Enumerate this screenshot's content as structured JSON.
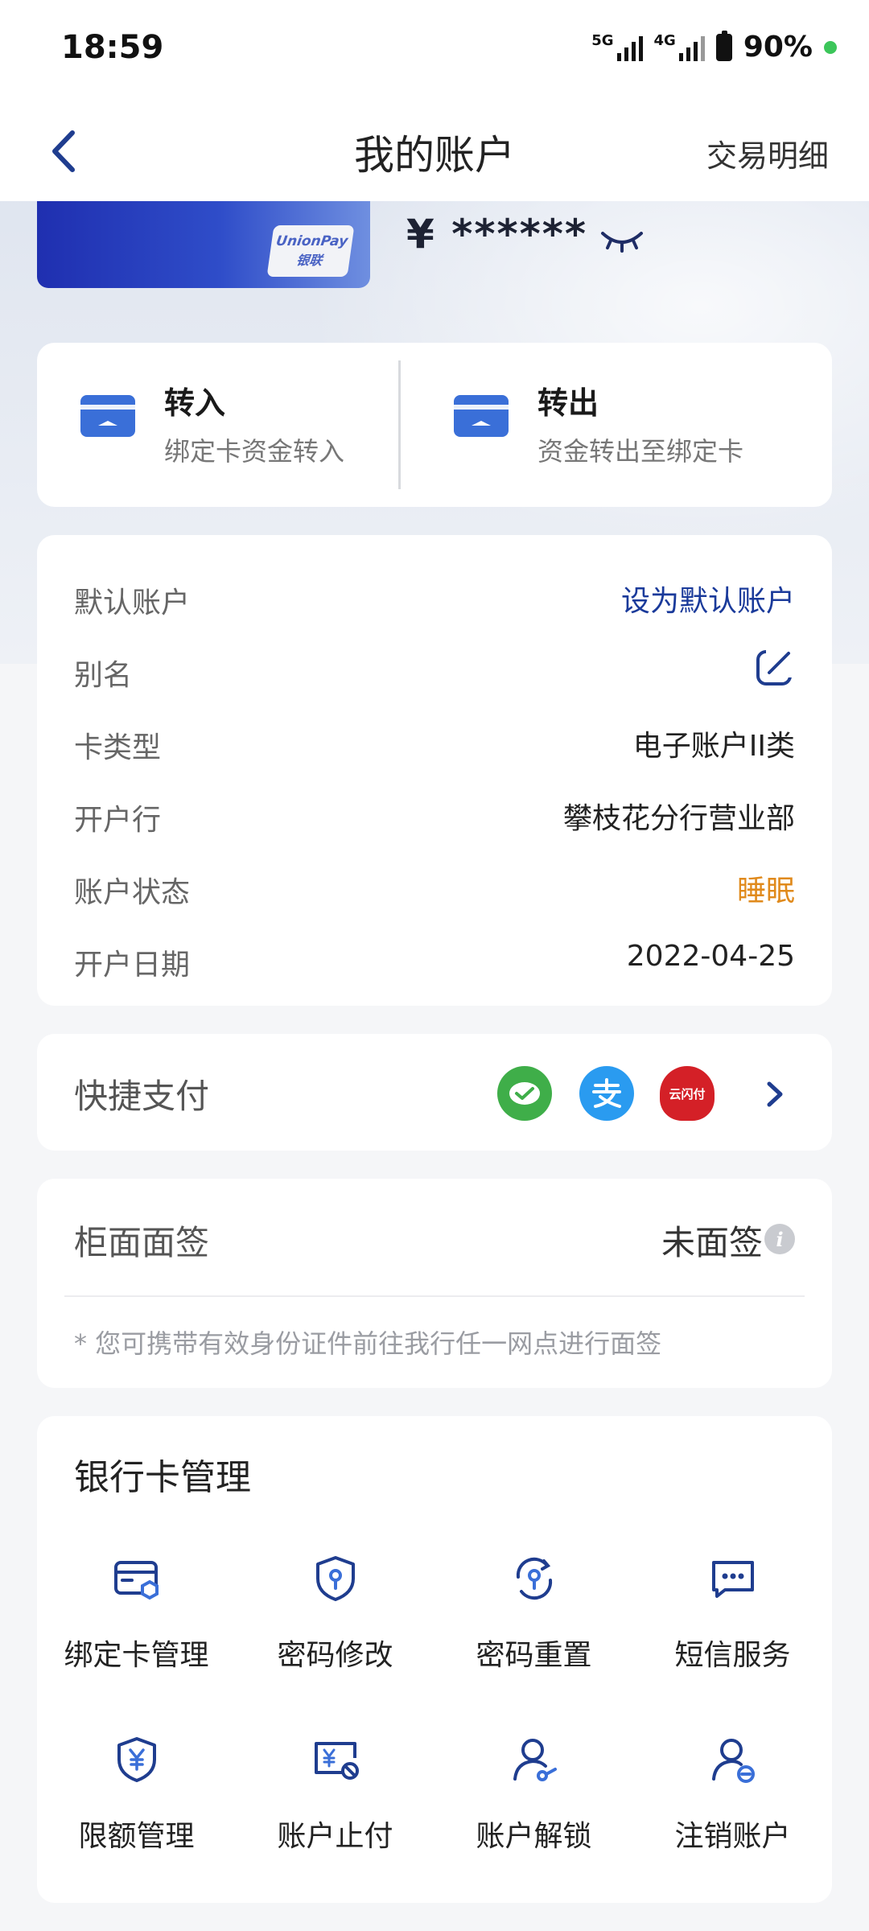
{
  "status_bar": {
    "time": "18:59",
    "network1": "5G",
    "network2": "4G",
    "battery": "90%"
  },
  "nav": {
    "title": "我的账户",
    "right_label": "交易明细"
  },
  "card": {
    "brand_line1": "UnionPay",
    "brand_line2": "银联",
    "balance": "¥ ******"
  },
  "transfer": {
    "in_title": "转入",
    "in_sub": "绑定卡资金转入",
    "out_title": "转出",
    "out_sub": "资金转出至绑定卡"
  },
  "info": {
    "rows": [
      {
        "label": "默认账户",
        "value": "设为默认账户"
      },
      {
        "label": "别名",
        "value": ""
      },
      {
        "label": "卡类型",
        "value": "电子账户II类"
      },
      {
        "label": "开户行",
        "value": "攀枝花分行营业部"
      },
      {
        "label": "账户状态",
        "value": "睡眠"
      },
      {
        "label": "开户日期",
        "value": "2022-04-25"
      }
    ]
  },
  "quick_pay": {
    "label": "快捷支付",
    "union_text": "云闪付"
  },
  "face_sign": {
    "label": "柜面面签",
    "value": "未面签",
    "note": "* 您可携带有效身份证件前往我行任一网点进行面签"
  },
  "management": {
    "title": "银行卡管理",
    "items": [
      {
        "label": "绑定卡管理",
        "icon": "bound-card-icon"
      },
      {
        "label": "密码修改",
        "icon": "password-change-icon"
      },
      {
        "label": "密码重置",
        "icon": "password-reset-icon"
      },
      {
        "label": "短信服务",
        "icon": "sms-icon"
      },
      {
        "label": "限额管理",
        "icon": "limit-icon"
      },
      {
        "label": "账户止付",
        "icon": "account-stop-icon"
      },
      {
        "label": "账户解锁",
        "icon": "account-unlock-icon"
      },
      {
        "label": "注销账户",
        "icon": "account-cancel-icon"
      }
    ]
  },
  "colors": {
    "accent": "#1a3a9a",
    "warn": "#e08a1c",
    "icon_blue": "#1f3d8f"
  }
}
